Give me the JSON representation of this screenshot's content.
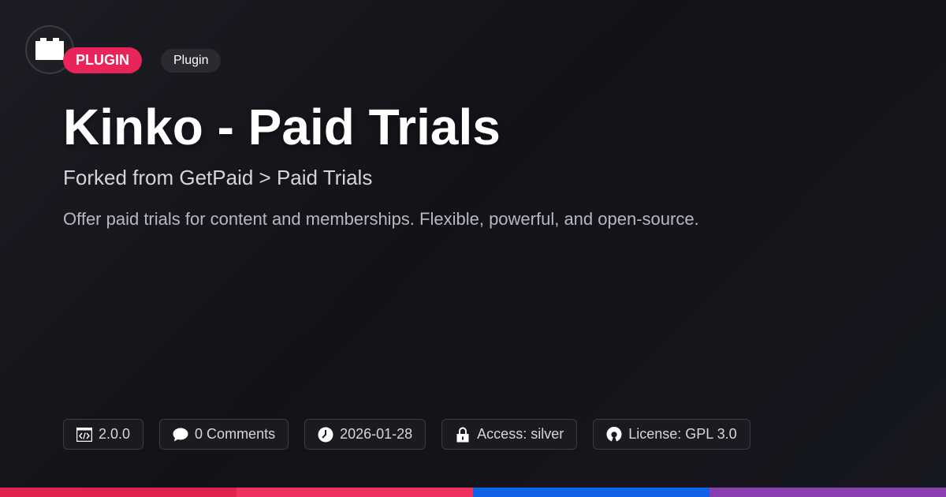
{
  "badges": {
    "category": "PLUGIN",
    "type": "Plugin"
  },
  "title": "Kinko - Paid Trials",
  "subtitle": "Forked from GetPaid > Paid Trials",
  "description": "Offer paid trials for content and memberships. Flexible, powerful, and open-source.",
  "meta": {
    "version": "2.0.0",
    "comments": "0 Comments",
    "date": "2026-01-28",
    "access": "Access: silver",
    "license": "License: GPL 3.0"
  },
  "icons": {
    "logo": "plugin-block-icon",
    "version": "code-icon",
    "comments": "speech-bubble-icon",
    "date": "clock-icon",
    "access": "lock-icon",
    "license": "open-source-icon"
  },
  "colors": {
    "accent": "#e8245a",
    "stripe": [
      "#e0224f",
      "#f0305e",
      "#0f62e6",
      "#8a3fb0"
    ]
  }
}
